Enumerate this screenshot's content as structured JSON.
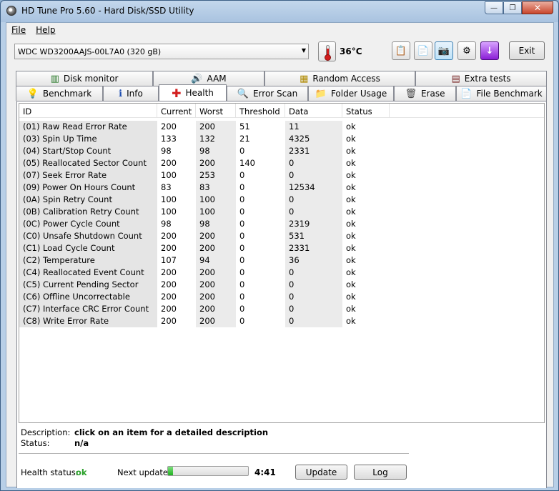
{
  "window": {
    "title": "HD Tune Pro 5.60 - Hard Disk/SSD Utility",
    "minimize": "—",
    "maximize": "❐",
    "close": "✕"
  },
  "menu": {
    "file": "File",
    "help": "Help"
  },
  "toolbar": {
    "drive": "WDC WD3200AAJS-00L7A0 (320 gB)",
    "temperature": "36°C",
    "exit_label": "Exit",
    "icons": [
      "copy-text-icon",
      "copy-report-icon",
      "screenshot-icon",
      "options-icon",
      "download-icon"
    ]
  },
  "tabs": {
    "row1": [
      {
        "label": "Disk monitor",
        "icon": "disk-monitor-icon"
      },
      {
        "label": "AAM",
        "icon": "speaker-icon"
      },
      {
        "label": "Random Access",
        "icon": "random-access-icon"
      },
      {
        "label": "Extra tests",
        "icon": "extra-tests-icon"
      }
    ],
    "row2": [
      {
        "label": "Benchmark",
        "icon": "lightbulb-icon"
      },
      {
        "label": "Info",
        "icon": "info-icon"
      },
      {
        "label": "Health",
        "icon": "red-cross-icon"
      },
      {
        "label": "Error Scan",
        "icon": "magnifier-icon"
      },
      {
        "label": "Folder Usage",
        "icon": "folder-icon"
      },
      {
        "label": "Erase",
        "icon": "trash-icon"
      },
      {
        "label": "File Benchmark",
        "icon": "file-benchmark-icon"
      }
    ],
    "selected": "Health"
  },
  "table": {
    "columns": [
      "ID",
      "Current",
      "Worst",
      "Threshold",
      "Data",
      "Status"
    ],
    "rows": [
      [
        "(01) Raw Read Error Rate",
        "200",
        "200",
        "51",
        "11",
        "ok"
      ],
      [
        "(03) Spin Up Time",
        "133",
        "132",
        "21",
        "4325",
        "ok"
      ],
      [
        "(04) Start/Stop Count",
        "98",
        "98",
        "0",
        "2331",
        "ok"
      ],
      [
        "(05) Reallocated Sector Count",
        "200",
        "200",
        "140",
        "0",
        "ok"
      ],
      [
        "(07) Seek Error Rate",
        "100",
        "253",
        "0",
        "0",
        "ok"
      ],
      [
        "(09) Power On Hours Count",
        "83",
        "83",
        "0",
        "12534",
        "ok"
      ],
      [
        "(0A) Spin Retry Count",
        "100",
        "100",
        "0",
        "0",
        "ok"
      ],
      [
        "(0B) Calibration Retry Count",
        "100",
        "100",
        "0",
        "0",
        "ok"
      ],
      [
        "(0C) Power Cycle Count",
        "98",
        "98",
        "0",
        "2319",
        "ok"
      ],
      [
        "(C0) Unsafe Shutdown Count",
        "200",
        "200",
        "0",
        "531",
        "ok"
      ],
      [
        "(C1) Load Cycle Count",
        "200",
        "200",
        "0",
        "2331",
        "ok"
      ],
      [
        "(C2) Temperature",
        "107",
        "94",
        "0",
        "36",
        "ok"
      ],
      [
        "(C4) Reallocated Event Count",
        "200",
        "200",
        "0",
        "0",
        "ok"
      ],
      [
        "(C5) Current Pending Sector",
        "200",
        "200",
        "0",
        "0",
        "ok"
      ],
      [
        "(C6) Offline Uncorrectable",
        "200",
        "200",
        "0",
        "0",
        "ok"
      ],
      [
        "(C7) Interface CRC Error Count",
        "200",
        "200",
        "0",
        "0",
        "ok"
      ],
      [
        "(C8) Write Error Rate",
        "200",
        "200",
        "0",
        "0",
        "ok"
      ]
    ]
  },
  "details": {
    "description_label": "Description:",
    "description_value": "click on an item for a detailed description",
    "status_label": "Status:",
    "status_value": "n/a"
  },
  "footer": {
    "health_label": "Health status:",
    "health_value": "ok",
    "next_update_label": "Next update:",
    "progress_fraction": 0.06,
    "countdown": "4:41",
    "update_label": "Update",
    "log_label": "Log"
  },
  "colors": {
    "ok_green": "#2aa02a",
    "title_bar": "#b8cfe7",
    "temp_red": "#d21d1d"
  }
}
